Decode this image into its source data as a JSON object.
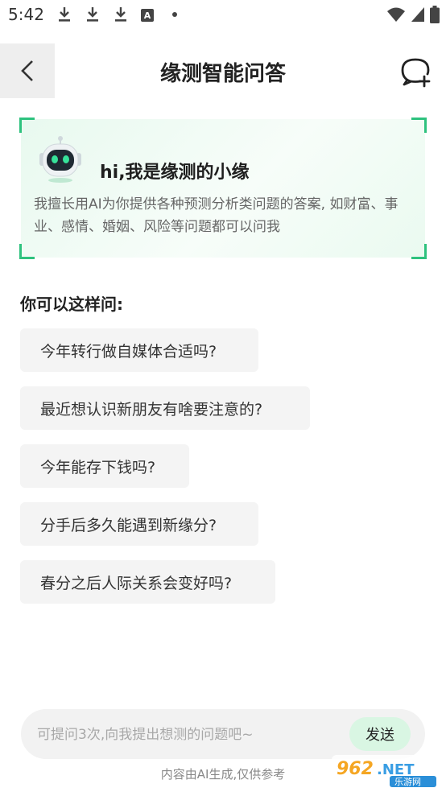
{
  "status_bar": {
    "time": "5:42",
    "left_icons": [
      "download-icon",
      "download-icon",
      "download-icon",
      "a-notification-icon",
      "dot-icon"
    ],
    "right_icons": [
      "wifi-icon",
      "signal-icon",
      "battery-icon"
    ]
  },
  "header": {
    "title": "缘测智能问答",
    "back_icon": "chevron-left-icon",
    "new_chat_icon": "chat-add-icon"
  },
  "intro": {
    "title": "hi,我是缘测的小缘",
    "description": "我擅长用AI为你提供各种预测分析类问题的答案, 如财富、事业、感情、婚姻、风险等问题都可以问我",
    "accent_color": "#2ec27e"
  },
  "suggestions": {
    "heading": "你可以这样问:",
    "items": [
      "今年转行做自媒体合适吗?",
      "最近想认识新朋友有啥要注意的?",
      "今年能存下钱吗?",
      "分手后多久能遇到新缘分?",
      "春分之后人际关系会变好吗?"
    ]
  },
  "input": {
    "placeholder": "可提问3次,向我提出想测的问题吧~",
    "value": "",
    "send_label": "发送"
  },
  "footer": {
    "disclaimer": "内容由AI生成,仅供参考"
  },
  "watermark": {
    "brand": "962.NET",
    "sub": "乐游网"
  }
}
